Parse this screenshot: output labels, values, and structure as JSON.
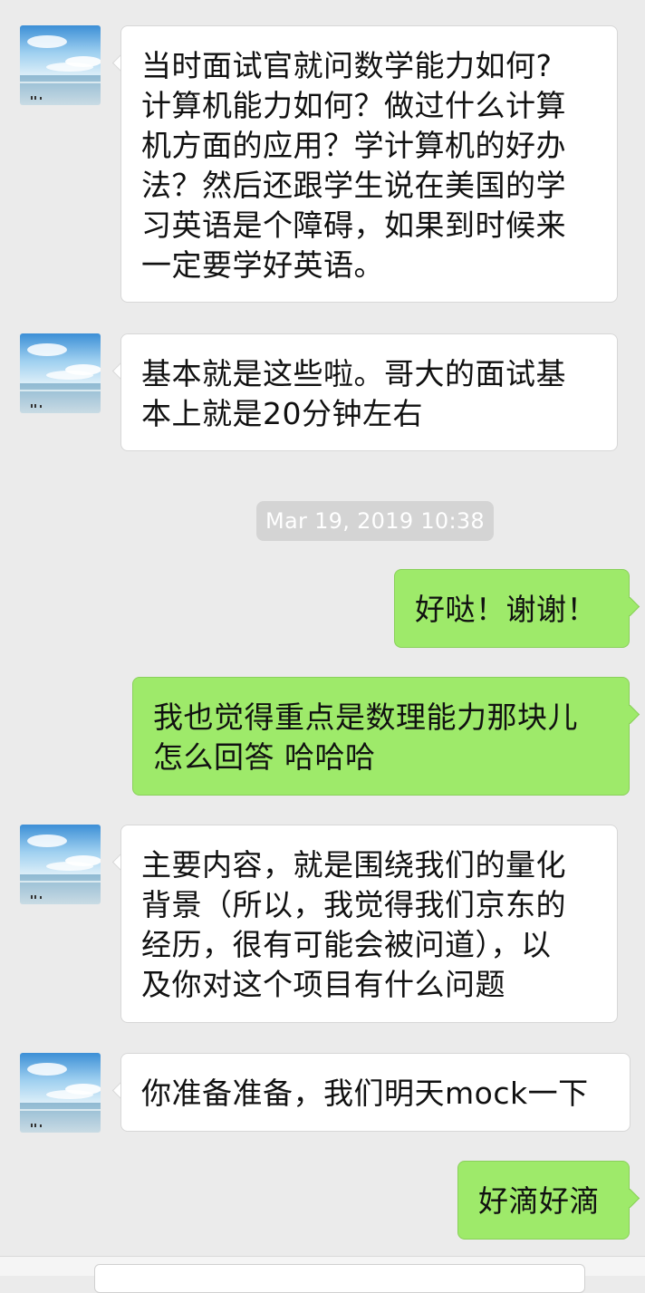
{
  "conversation": {
    "messages": [
      {
        "sender": "contact",
        "text": "当时面试官就问数学能力如何?\n计算机能力如何？做过什么计算\n机方面的应用？学计算机的好办\n法？然后还跟学生说在美国的学\n习英语是个障碍，如果到时候来\n一定要学好英语。"
      },
      {
        "sender": "contact",
        "text": "基本就是这些啦。哥大的面试基\n本上就是20分钟左右"
      },
      {
        "sender": "me",
        "text": "好哒！谢谢！"
      },
      {
        "sender": "me",
        "text": "我也觉得重点是数理能力那块儿\n怎么回答 哈哈哈"
      },
      {
        "sender": "contact",
        "text": "主要内容，就是围绕我们的量化\n背景（所以，我觉得我们京东的\n经历，很有可能会被问道），以\n及你对这个项目有什么问题"
      },
      {
        "sender": "contact",
        "text": "你准备准备，我们明天mock一下"
      },
      {
        "sender": "me",
        "text": "好滴好滴"
      }
    ],
    "timestamp": "Mar 19, 2019 10:38"
  },
  "colors": {
    "background": "#ebebeb",
    "incoming_bubble": "#ffffff",
    "outgoing_bubble": "#9eea6a",
    "timestamp_pill": "#d4d4d4"
  },
  "icons": {
    "avatar": "beach-landscape-avatar"
  }
}
